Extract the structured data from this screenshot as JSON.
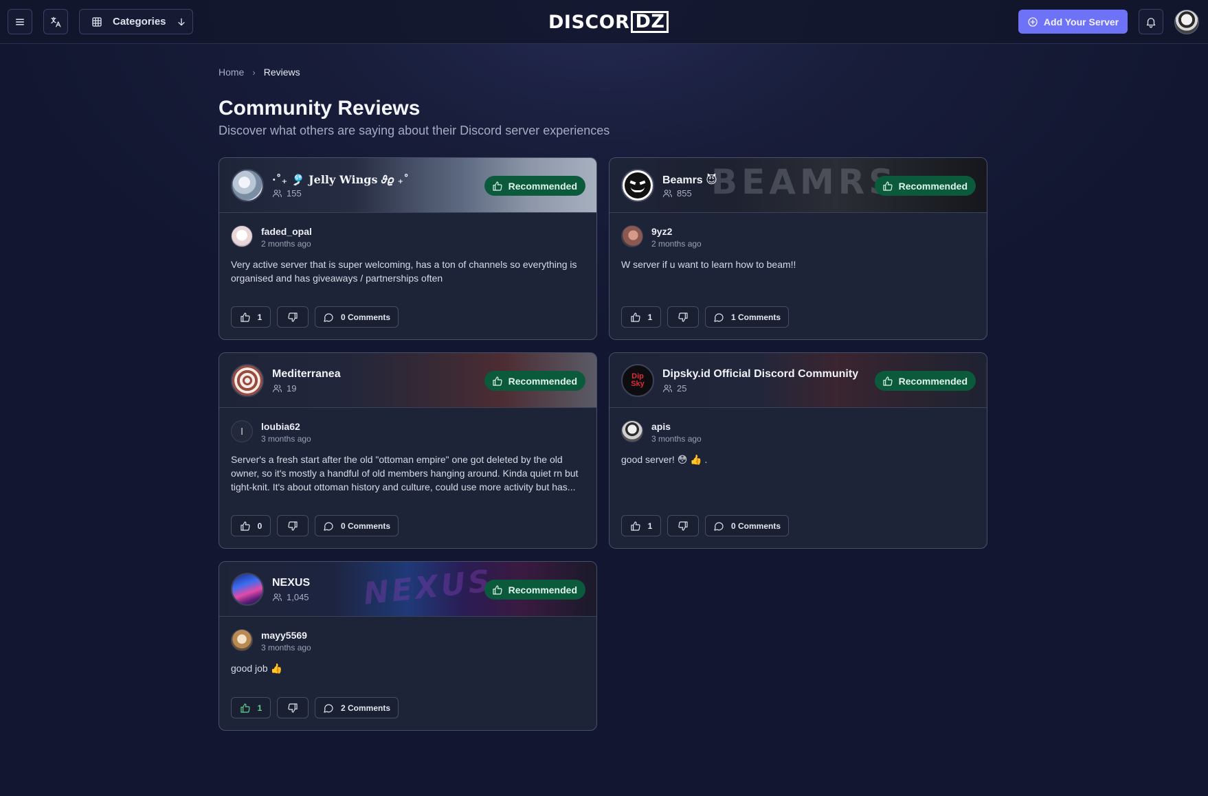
{
  "header": {
    "categories_label": "Categories",
    "logo_main": "DISCOR",
    "logo_box": "DZ",
    "add_server_label": "Add Your Server"
  },
  "breadcrumb": {
    "home": "Home",
    "current": "Reviews"
  },
  "page": {
    "title": "Community Reviews",
    "subtitle": "Discover what others are saying about their Discord server experiences"
  },
  "recommended_label": "Recommended",
  "reviews": [
    {
      "server_name": "·˚₊ 🎐 Jelly Wings 𝜗𝜚 ₊˚",
      "members": "155",
      "reviewer": "faded_opal",
      "time": "2 months ago",
      "text": "Very active server that is super welcoming, has a ton of channels so everything is organised and has giveaways / partnerships often",
      "likes": "1",
      "comments": "0 Comments"
    },
    {
      "server_name": "Beamrs",
      "server_badge": "😈",
      "banner_text": "BEAMRS",
      "members": "855",
      "reviewer": "9yz2",
      "time": "2 months ago",
      "text": "W server if u want to learn how to beam!!",
      "likes": "1",
      "comments": "1 Comments"
    },
    {
      "server_name": "Mediterranea",
      "members": "19",
      "reviewer": "loubia62",
      "reviewer_initial": "l",
      "time": "3 months ago",
      "text": "Server's a fresh start after the old \"ottoman empire\" one got deleted by the old owner, so it's mostly a handful of old members hanging around. Kinda quiet rn but tight-knit. It's about ottoman history and culture, could use more activity but has...",
      "likes": "0",
      "comments": "0 Comments"
    },
    {
      "server_name": "Dipsky.id Official Discord Community",
      "avatar_text": "Dip Sky",
      "members": "25",
      "reviewer": "apis",
      "time": "3 months ago",
      "text": "good server! 😳 👍 .",
      "likes": "1",
      "comments": "0 Comments"
    },
    {
      "server_name": "NEXUS",
      "banner_text": "NEXUS",
      "members": "1,045",
      "reviewer": "mayy5569",
      "time": "3 months ago",
      "text": "good job 👍",
      "likes": "1",
      "comments": "2 Comments"
    }
  ]
}
